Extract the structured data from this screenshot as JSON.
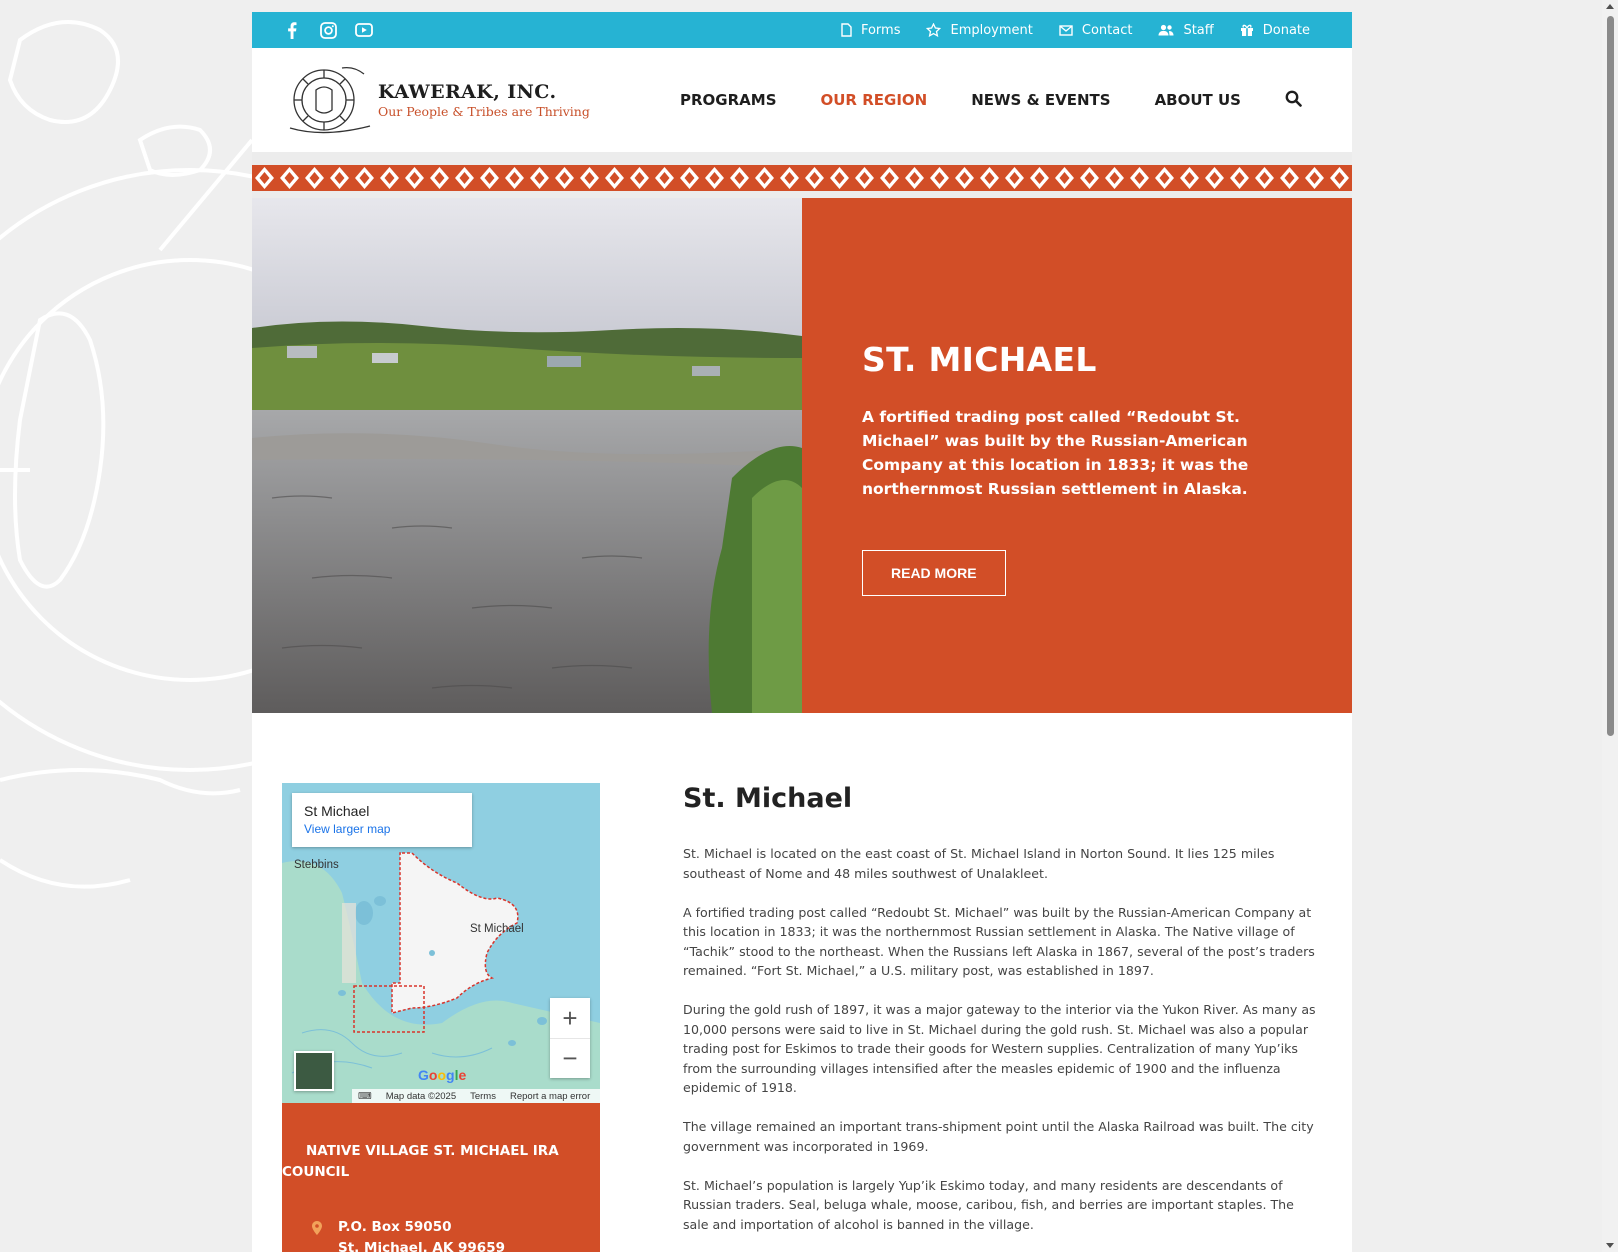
{
  "topbar": {
    "social": [
      "facebook-icon",
      "instagram-icon",
      "youtube-icon"
    ],
    "links": [
      {
        "label": "Forms",
        "icon": "file-icon"
      },
      {
        "label": "Employment",
        "icon": "star-icon"
      },
      {
        "label": "Contact",
        "icon": "envelope-icon"
      },
      {
        "label": "Staff",
        "icon": "users-icon"
      },
      {
        "label": "Donate",
        "icon": "gift-icon"
      }
    ]
  },
  "header": {
    "logo_name": "KAWERAK, INC.",
    "logo_tagline": "Our People & Tribes are Thriving",
    "nav": {
      "programs": "PROGRAMS",
      "region": "OUR REGION",
      "news": "NEWS & EVENTS",
      "about": "ABOUT US"
    }
  },
  "hero": {
    "title": "ST. MICHAEL",
    "text": "A fortified trading post called “Redoubt St. Michael” was built by the Russian-American Company at this location in 1833; it was the northernmost Russian settlement in Alaska.",
    "button": "READ MORE"
  },
  "map": {
    "place": "St Michael",
    "larger_map": "View larger map",
    "label_stebbins": "Stebbins",
    "label_town": "St Michael",
    "google": "Google",
    "map_data": "Map data ©2025",
    "terms": "Terms",
    "report": "Report a map error",
    "zoom_in": "+",
    "zoom_out": "−"
  },
  "council": {
    "title": "NATIVE VILLAGE ST. MICHAEL IRA COUNCIL",
    "address_line1": "P.O. Box 59050",
    "address_line2": "St. Michael, AK 99659"
  },
  "article": {
    "heading": "St. Michael",
    "paragraphs": [
      "St. Michael is located on the east coast of St. Michael Island in Norton Sound. It lies 125 miles southeast of Nome and 48 miles southwest of Unalakleet.",
      "A fortified trading post called “Redoubt St. Michael” was built by the Russian-American Company at this location in 1833; it was the northernmost Russian settlement in Alaska. The Native village of “Tachik” stood to the northeast. When the Russians left Alaska in 1867, several of the post’s traders remained. “Fort St. Michael,” a U.S. military post, was established in 1897.",
      "During the gold rush of 1897, it was a major gateway to the interior via the Yukon River. As many as 10,000 persons were said to live in St. Michael during the gold rush. St. Michael was also a popular trading post for Eskimos to trade their goods for Western supplies. Centralization of many Yup’iks from the surrounding villages intensified after the measles epidemic of 1900 and the influenza epidemic of 1918.",
      "The village remained an important trans-shipment point until the Alaska Railroad was built. The city government was incorporated in 1969.",
      "St. Michael’s population is largely Yup’ik Eskimo today, and many residents are descendants of Russian traders. Seal, beluga whale, moose, caribou, fish, and berries are important staples. The sale and importation of alcohol is banned in the village."
    ]
  },
  "colors": {
    "topbar": "#26b3d3",
    "accent": "#d24e27",
    "text": "#444444"
  }
}
